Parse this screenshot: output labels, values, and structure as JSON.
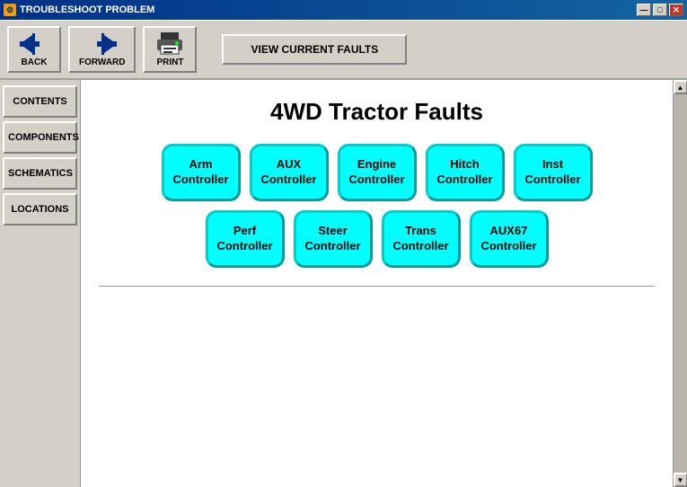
{
  "window": {
    "title": "TROUBLESHOOT PROBLEM",
    "icon": "⚙"
  },
  "titleButtons": {
    "minimize": "—",
    "maximize": "□",
    "close": "✕"
  },
  "toolbar": {
    "back_label": "BACK",
    "forward_label": "FORWARD",
    "print_label": "PRINT",
    "view_faults_label": "VIEW CURRENT FAULTS"
  },
  "sidebar": {
    "items": [
      {
        "id": "contents",
        "label": "CONTENTS"
      },
      {
        "id": "components",
        "label": "COMPONENTS"
      },
      {
        "id": "schematics",
        "label": "SCHEMATICS"
      },
      {
        "id": "locations",
        "label": "LOCATIONS"
      }
    ]
  },
  "main": {
    "title": "4WD Tractor Faults",
    "row1": [
      {
        "id": "arm",
        "label": "Arm\nController"
      },
      {
        "id": "aux",
        "label": "AUX\nController"
      },
      {
        "id": "engine",
        "label": "Engine\nController"
      },
      {
        "id": "hitch",
        "label": "Hitch\nController"
      },
      {
        "id": "inst",
        "label": "Inst\nController"
      }
    ],
    "row2": [
      {
        "id": "perf",
        "label": "Perf\nController"
      },
      {
        "id": "steer",
        "label": "Steer\nController"
      },
      {
        "id": "trans",
        "label": "Trans\nController"
      },
      {
        "id": "aux67",
        "label": "AUX67\nController"
      }
    ]
  },
  "icons": {
    "back_arrow": "←",
    "forward_arrow": "→",
    "print": "🖨",
    "scroll_up": "▲",
    "scroll_down": "▼"
  },
  "colors": {
    "cyan": "#00ffff",
    "titlebar_start": "#003087",
    "titlebar_end": "#1464a0"
  }
}
